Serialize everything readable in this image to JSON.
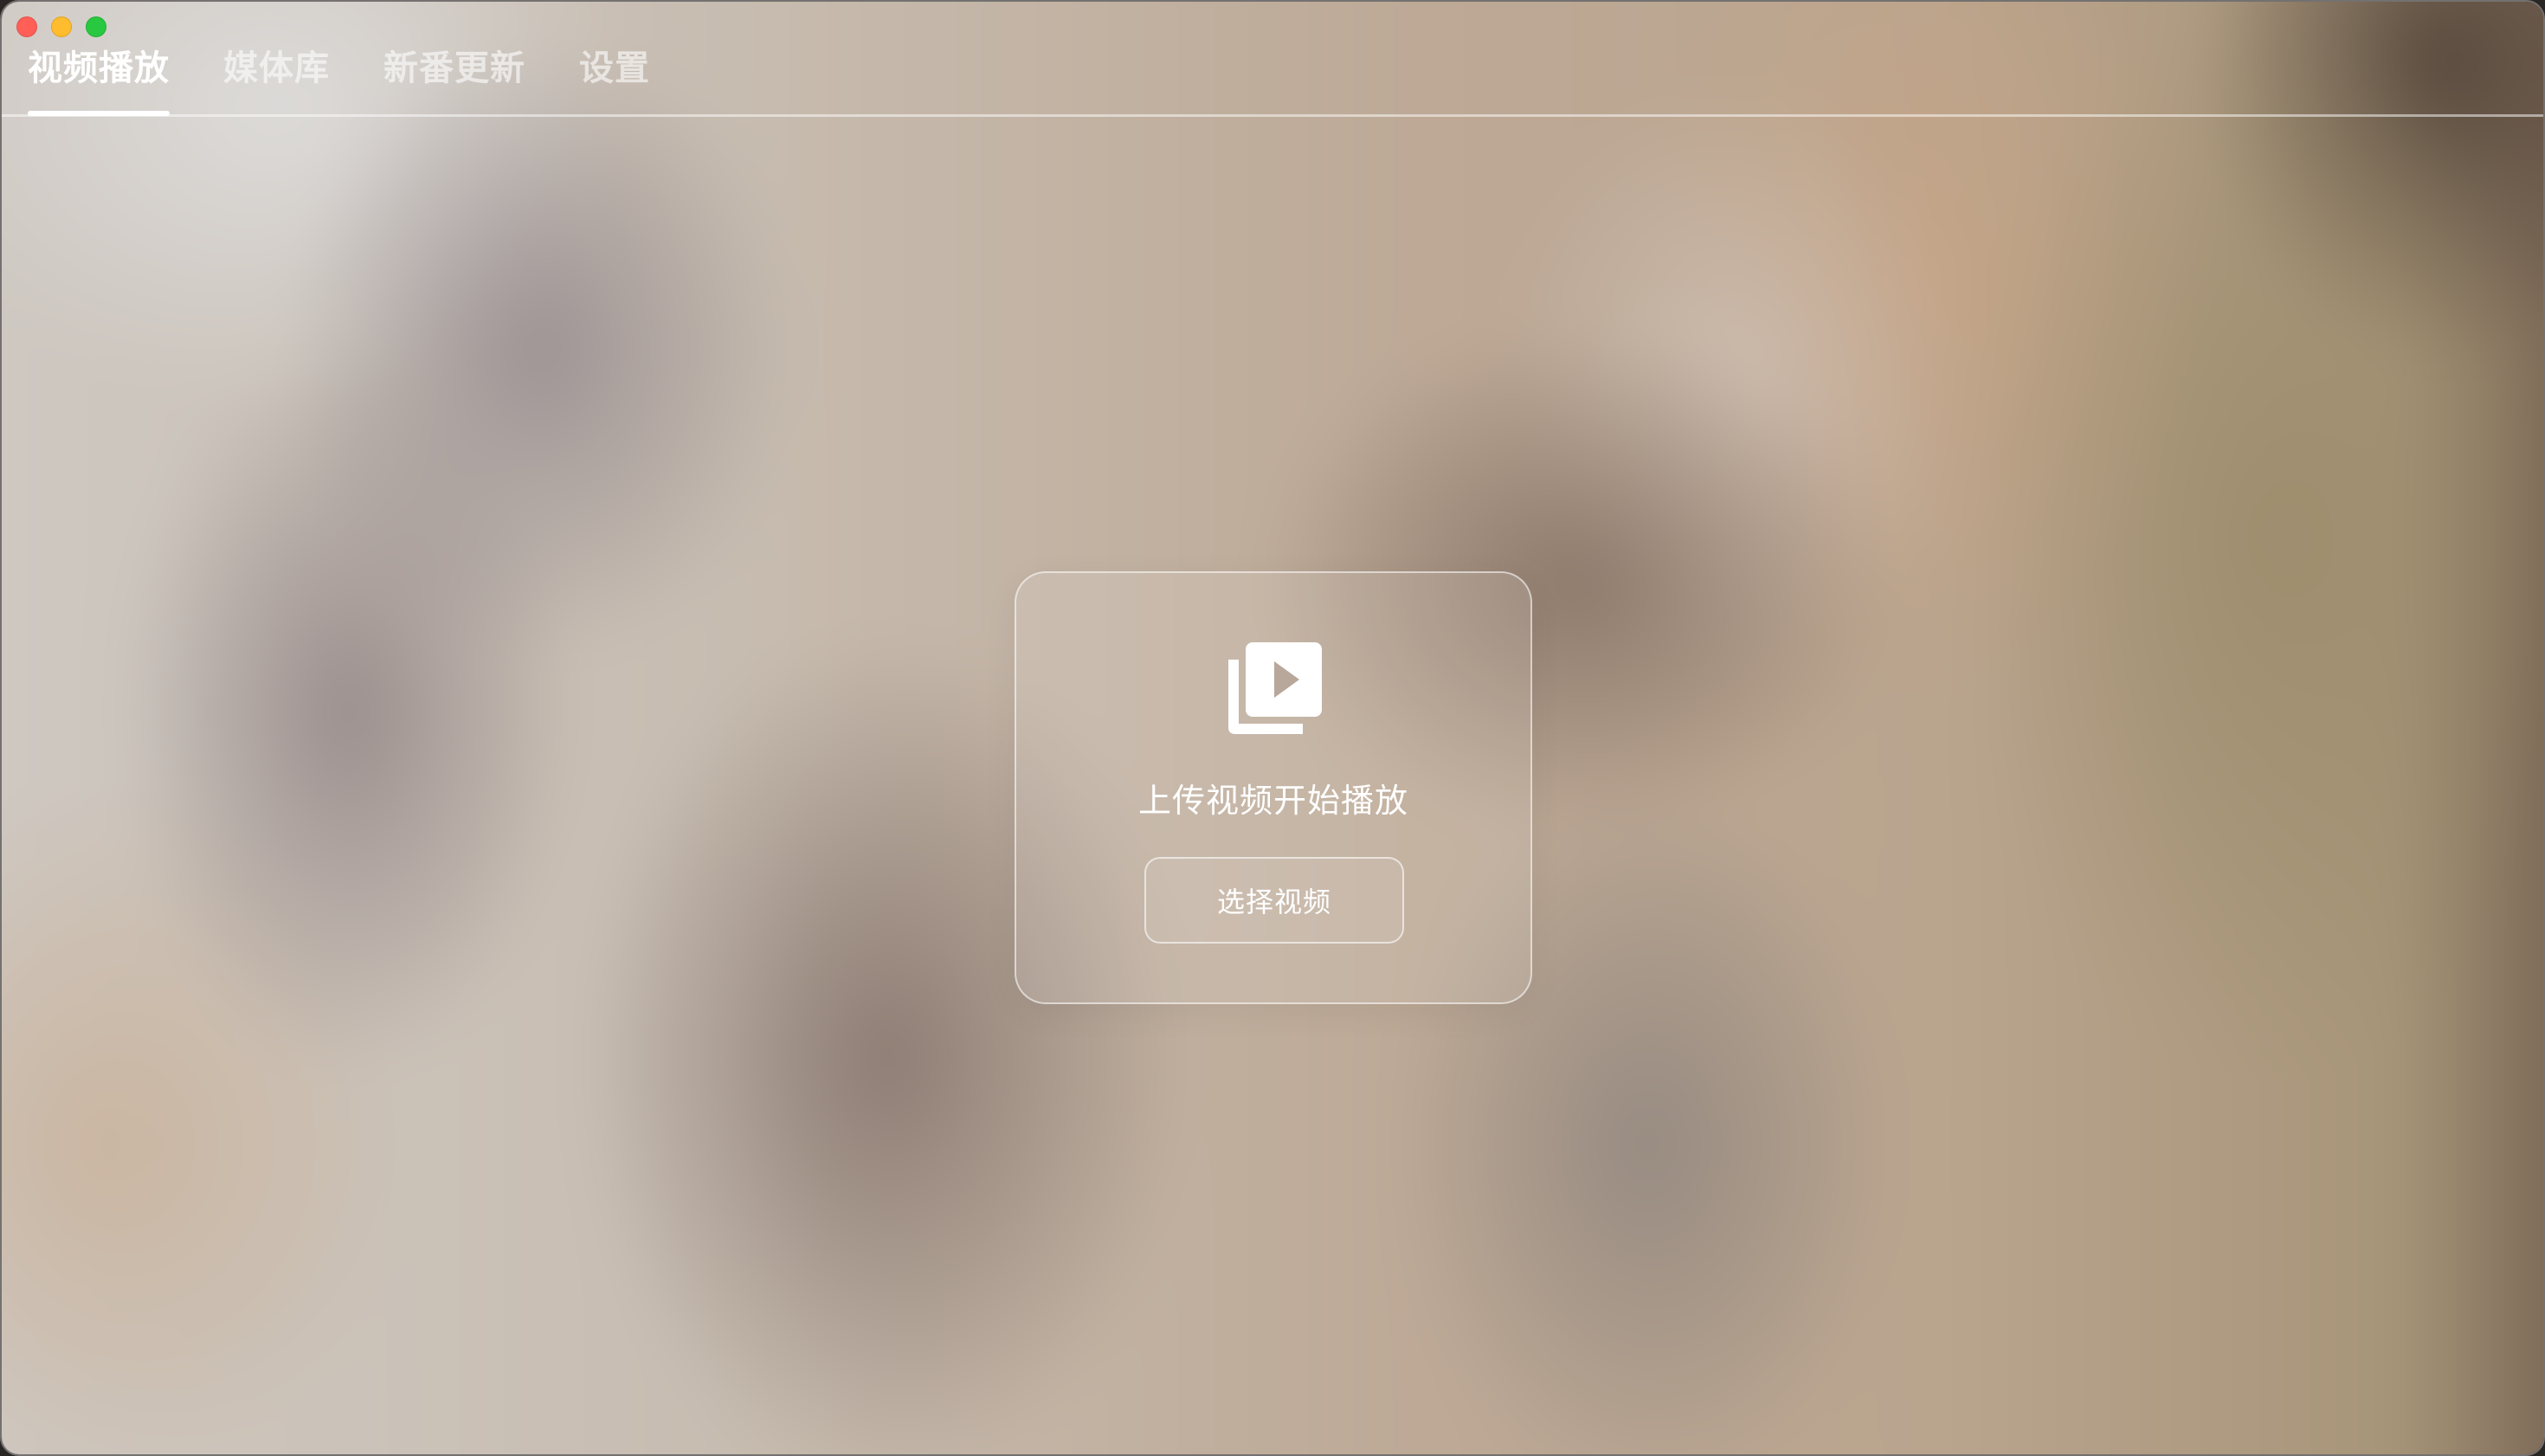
{
  "window": {
    "controls": {
      "close": "red",
      "minimize": "yellow",
      "zoom": "green"
    }
  },
  "tabs": [
    {
      "label": "视频播放",
      "active": true
    },
    {
      "label": "媒体库",
      "active": false
    },
    {
      "label": "新番更新",
      "active": false
    },
    {
      "label": "设置",
      "active": false
    }
  ],
  "upload": {
    "icon": "video-library-icon",
    "title": "上传视频开始播放",
    "button_label": "选择视频"
  },
  "colors": {
    "traffic_red": "#ff5f57",
    "traffic_yellow": "#febc2e",
    "traffic_green": "#28c840",
    "active_tab": "#ffffff",
    "inactive_tab": "rgba(255,255,255,0.6)"
  }
}
